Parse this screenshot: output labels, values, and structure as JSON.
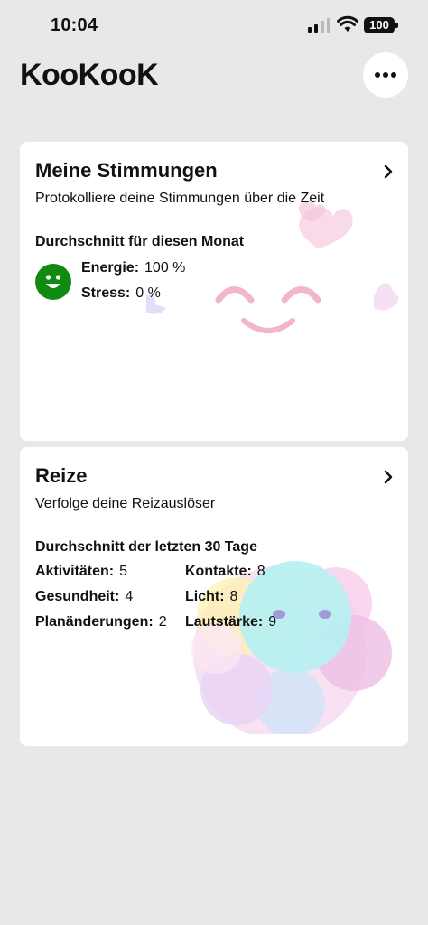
{
  "status_bar": {
    "time": "10:04",
    "battery": "100",
    "icons": [
      "cellular-signal-icon",
      "wifi-icon",
      "battery-icon"
    ]
  },
  "header": {
    "app_title": "KooKooK",
    "more_icon": "ellipsis-icon"
  },
  "moods_card": {
    "title": "Meine Stimmungen",
    "subtitle": "Protokolliere deine Stimmungen über die Zeit",
    "section_title": "Durchschnitt für diesen Monat",
    "face_color": "#108a10",
    "energy_label": "Energie:",
    "energy_value": "100 %",
    "stress_label": "Stress:",
    "stress_value": "0 %"
  },
  "stimuli_card": {
    "title": "Reize",
    "subtitle": "Verfolge deine Reizauslöser",
    "section_title": "Durchschnitt der letzten 30 Tage",
    "items": [
      {
        "label": "Aktivitäten:",
        "value": "5"
      },
      {
        "label": "Kontakte:",
        "value": "8"
      },
      {
        "label": "Gesundheit:",
        "value": "4"
      },
      {
        "label": "Licht:",
        "value": "8"
      },
      {
        "label": "Planänderungen:",
        "value": "2"
      },
      {
        "label": "Lautstärke:",
        "value": "9"
      }
    ]
  }
}
